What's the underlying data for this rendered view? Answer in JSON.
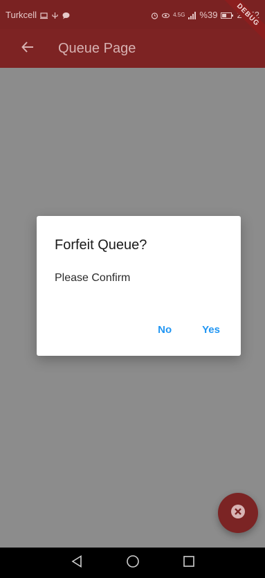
{
  "status_bar": {
    "carrier": "Turkcell",
    "network": "4.5G",
    "battery": "%39",
    "time": "20:52"
  },
  "app_bar": {
    "title": "Queue Page",
    "debug_banner": "DEBUG"
  },
  "dialog": {
    "title": "Forfeit Queue?",
    "content": "Please Confirm",
    "actions": {
      "no_label": "No",
      "yes_label": "Yes"
    }
  },
  "colors": {
    "app_bar": "#7d2323",
    "action_blue": "#2196f3",
    "fab": "#7b2424",
    "scrim": "#8c8c8c"
  },
  "icons": {
    "back": "arrow-left-icon",
    "fab": "close-circle-icon",
    "nav_back": "triangle-back-icon",
    "nav_home": "circle-home-icon",
    "nav_recents": "square-recents-icon"
  }
}
